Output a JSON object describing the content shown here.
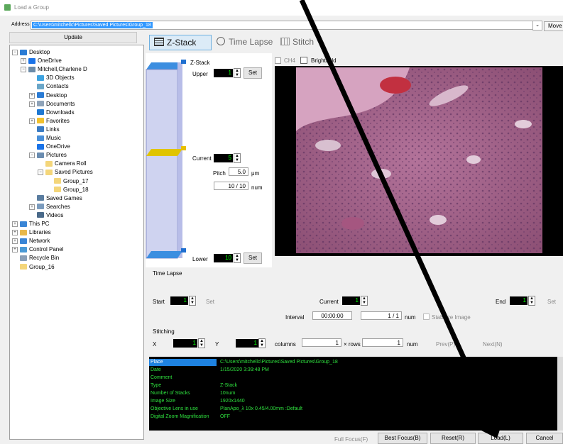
{
  "window": {
    "title": "Load a Group"
  },
  "address": {
    "label": "Address",
    "value": "C:\\Users\\mitchellc\\Pictures\\Saved Pictures\\Group_18",
    "move_label": "Move"
  },
  "update_label": "Update",
  "tree": {
    "items": [
      {
        "label": "Desktop",
        "indent": 0,
        "color": "#2a7bd4"
      },
      {
        "label": "OneDrive",
        "indent": 1,
        "color": "#1a73e8"
      },
      {
        "label": "Mitchell,Charlene D",
        "indent": 1,
        "color": "#6b8ba8"
      },
      {
        "label": "3D Objects",
        "indent": 2,
        "color": "#3da3e0"
      },
      {
        "label": "Contacts",
        "indent": 2,
        "color": "#6aa6c8"
      },
      {
        "label": "Desktop",
        "indent": 2,
        "color": "#2a7bd4"
      },
      {
        "label": "Documents",
        "indent": 2,
        "color": "#8fa3b8"
      },
      {
        "label": "Downloads",
        "indent": 2,
        "color": "#1f78d1"
      },
      {
        "label": "Favorites",
        "indent": 2,
        "color": "#f2c12e"
      },
      {
        "label": "Links",
        "indent": 2,
        "color": "#3b7cc4"
      },
      {
        "label": "Music",
        "indent": 2,
        "color": "#4a90d9"
      },
      {
        "label": "OneDrive",
        "indent": 2,
        "color": "#1a73e8"
      },
      {
        "label": "Pictures",
        "indent": 2,
        "color": "#6a8cb0"
      },
      {
        "label": "Camera Roll",
        "indent": 3,
        "color": "#f4d67a"
      },
      {
        "label": "Saved Pictures",
        "indent": 3,
        "color": "#f4d67a"
      },
      {
        "label": "Group_17",
        "indent": 4,
        "color": "#f4d67a"
      },
      {
        "label": "Group_18",
        "indent": 4,
        "color": "#f4d67a"
      },
      {
        "label": "Saved Games",
        "indent": 2,
        "color": "#5a7da0"
      },
      {
        "label": "Searches",
        "indent": 2,
        "color": "#7b9bbd"
      },
      {
        "label": "Videos",
        "indent": 2,
        "color": "#4a6a8a"
      },
      {
        "label": "This PC",
        "indent": 0,
        "color": "#3a86d6"
      },
      {
        "label": "Libraries",
        "indent": 0,
        "color": "#e8b84a"
      },
      {
        "label": "Network",
        "indent": 0,
        "color": "#3a86d6"
      },
      {
        "label": "Control Panel",
        "indent": 0,
        "color": "#4a9ad6"
      },
      {
        "label": "Recycle Bin",
        "indent": 0,
        "color": "#8aa0b8"
      },
      {
        "label": "Group_16",
        "indent": 0,
        "color": "#f4d67a"
      }
    ]
  },
  "tabs": {
    "zstack": "Z-Stack",
    "timelapse": "Time Lapse",
    "stitch": "Stitch"
  },
  "zstack": {
    "section": "Z-Stack",
    "upper_label": "Upper",
    "upper_value": "1",
    "current_label": "Current",
    "current_value": "5",
    "pitch_label": "Pitch",
    "pitch_value": "5.0",
    "pitch_unit": "μm",
    "num_value": "10 / 10",
    "num_unit": "num",
    "lower_label": "Lower",
    "lower_value": "10",
    "set_label": "Set"
  },
  "channels": {
    "ch4": "CH4",
    "brightfield": "Brightfield"
  },
  "timelapse": {
    "section": "Time Lapse",
    "start_label": "Start",
    "start_value": "1",
    "set_label": "Set",
    "current_label": "Current",
    "current_value": "1",
    "end_label": "End",
    "end_value": "1",
    "interval_label": "Interval",
    "interval_value": "00:00:00",
    "num_value": "1 / 1",
    "num_unit": "num",
    "stabilize_label": "Stabilize Image"
  },
  "stitching": {
    "section": "Stitching",
    "x_label": "X",
    "x_value": "1",
    "y_label": "Y",
    "y_value": "1",
    "columns_label": "columns",
    "columns_value": "1",
    "rows_label": "× rows",
    "rows_value": "1",
    "num_unit": "num",
    "prev_label": "Prev(P)",
    "next_label": "Next(N)"
  },
  "info": {
    "rows": [
      {
        "label": "Place",
        "value": "C:\\Users\\mitchellc\\Pictures\\Saved Pictures\\Group_18"
      },
      {
        "label": "Date",
        "value": "1/15/2020 3:39:48 PM"
      },
      {
        "label": "Comment",
        "value": ""
      },
      {
        "label": "Type",
        "value": "Z-Stack"
      },
      {
        "label": "Number of Stacks",
        "value": "10num"
      },
      {
        "label": "Image Size",
        "value": "1920x1440"
      },
      {
        "label": "Objective Lens in use",
        "value": "PlanApo_λ 10x 0.45/4.00mm :Default"
      },
      {
        "label": "Digital Zoom Magnification",
        "value": "OFF"
      }
    ]
  },
  "buttons": {
    "full_focus": "Full Focus(F)",
    "best_focus": "Best Focus(B)",
    "reset": "Reset(R)",
    "load": "Load(L)",
    "cancel": "Cancel"
  }
}
